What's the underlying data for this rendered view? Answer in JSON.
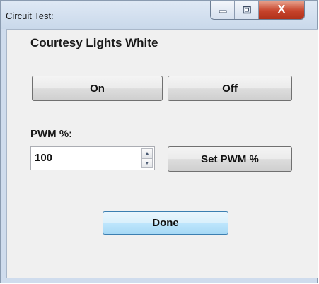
{
  "window": {
    "title": "Circuit Test:",
    "minimize_icon": "minimize-icon",
    "maximize_icon": "maximize-icon",
    "close_glyph": "X"
  },
  "dialog": {
    "circuit_name": "Courtesy Lights White",
    "on_label": "On",
    "off_label": "Off",
    "pwm_label": "PWM %:",
    "pwm_value": "100",
    "set_pwm_label": "Set PWM %",
    "done_label": "Done"
  },
  "icons": {
    "spin_up": "up-arrow-icon",
    "spin_down": "down-arrow-icon"
  },
  "colors": {
    "close_button": "#c7442c",
    "default_button_border": "#3c7fb1",
    "client_background": "#f0f0f0"
  }
}
